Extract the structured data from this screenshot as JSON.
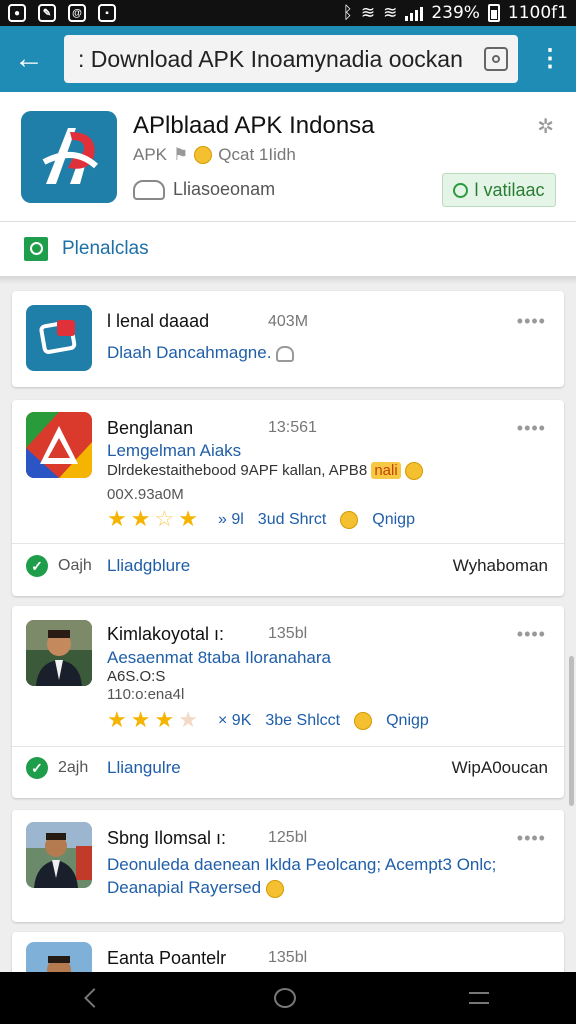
{
  "status_bar": {
    "battery": "239%",
    "time": "1100f1",
    "icons": [
      "messenger-icon",
      "edit-icon",
      "at-icon",
      "image-icon",
      "bluetooth-icon",
      "wifi-icon",
      "wifi-icon",
      "signal-icon",
      "battery-icon"
    ]
  },
  "app_bar": {
    "search_value": ": Download APK Inoamynadia oockan",
    "search_placeholder": "",
    "colors": {
      "bar": "#1f8cb5"
    }
  },
  "header": {
    "title": "APlblaad APK Indonsa",
    "sub_prefix": "APK",
    "sub_suffix": "Qcat 1Iidh",
    "developer": "Lliasoeonam",
    "install_label": "l vatilaac"
  },
  "section": {
    "label": "Plenalclas"
  },
  "cards": [
    {
      "name": "l lenal daaad",
      "size": "403M",
      "subtitle": "Dlaah Dancahmagne."
    },
    {
      "name": "Benglanan",
      "size": "13:561",
      "subtitle": "Lemgelman Aiaks",
      "description": "Dlrdekestaithebood 9APF kallan, APB8",
      "badge": "nali",
      "meta_line": "00X.93a0M",
      "rating": 3.5,
      "stats": [
        "9l",
        "3ud Shrct",
        "Qnigp"
      ],
      "footer_label": "Oajh",
      "footer_link": "Lliadgblure",
      "footer_right": "Wyhaboman"
    },
    {
      "name": "Kimlakoyotal ı:",
      "size": "135bl",
      "subtitle": "Aesaenmat 8taba Iloranahara",
      "description": "A6S.O:S",
      "meta_line": "110:o:ena4l",
      "rating": 3.5,
      "stats": [
        "9K",
        "3be Shlcct",
        "Qnigp"
      ],
      "footer_label": "2ajh",
      "footer_link": "Lliangulre",
      "footer_right": "WipA0oucan"
    },
    {
      "name": "Sbng Ilomsal ı:",
      "size": "125bl",
      "subtitle": "Deonuleda daenean Iklda Peolcang; Acempt3 Onlc;",
      "subtitle2": "Deanapial Rayersed"
    },
    {
      "name": "Eanta Poantelr",
      "size": "135bl"
    }
  ]
}
